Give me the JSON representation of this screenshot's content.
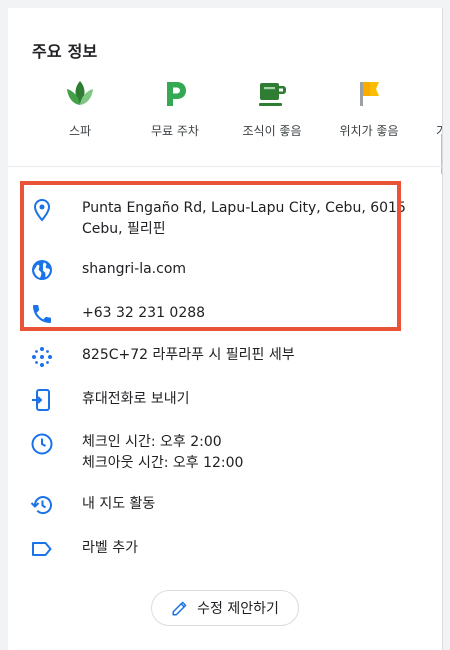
{
  "section": {
    "title": "주요 정보"
  },
  "amenities": [
    {
      "label": "스파",
      "icon": "spa-icon"
    },
    {
      "label": "무료 주차",
      "icon": "parking-icon"
    },
    {
      "label": "조식이 좋음",
      "icon": "breakfast-icon"
    },
    {
      "label": "위치가 좋음",
      "icon": "location-flag-icon"
    }
  ],
  "amenity_partial": "가",
  "contact": {
    "address_line1": "Punta Engaño Rd, Lapu-Lapu City, Cebu, 6015",
    "address_line2": "Cebu, 필리핀",
    "website": "shangri-la.com",
    "phone": "+63 32 231 0288"
  },
  "details": {
    "plus_code": "825C+72 라푸라푸 시 필리핀 세부",
    "send_to_phone": "휴대전화로 보내기",
    "checkin": "체크인 시간: 오후 2:00",
    "checkout": "체크아웃 시간: 오후 12:00",
    "map_activity": "내 지도 활동",
    "add_label": "라벨 추가"
  },
  "actions": {
    "suggest_edit": "수정 제안하기"
  },
  "colors": {
    "accent_blue": "#1a73e8",
    "highlight_border": "#ea5337",
    "parking_green": "#34a853",
    "flag_yellow": "#fbbc04"
  }
}
